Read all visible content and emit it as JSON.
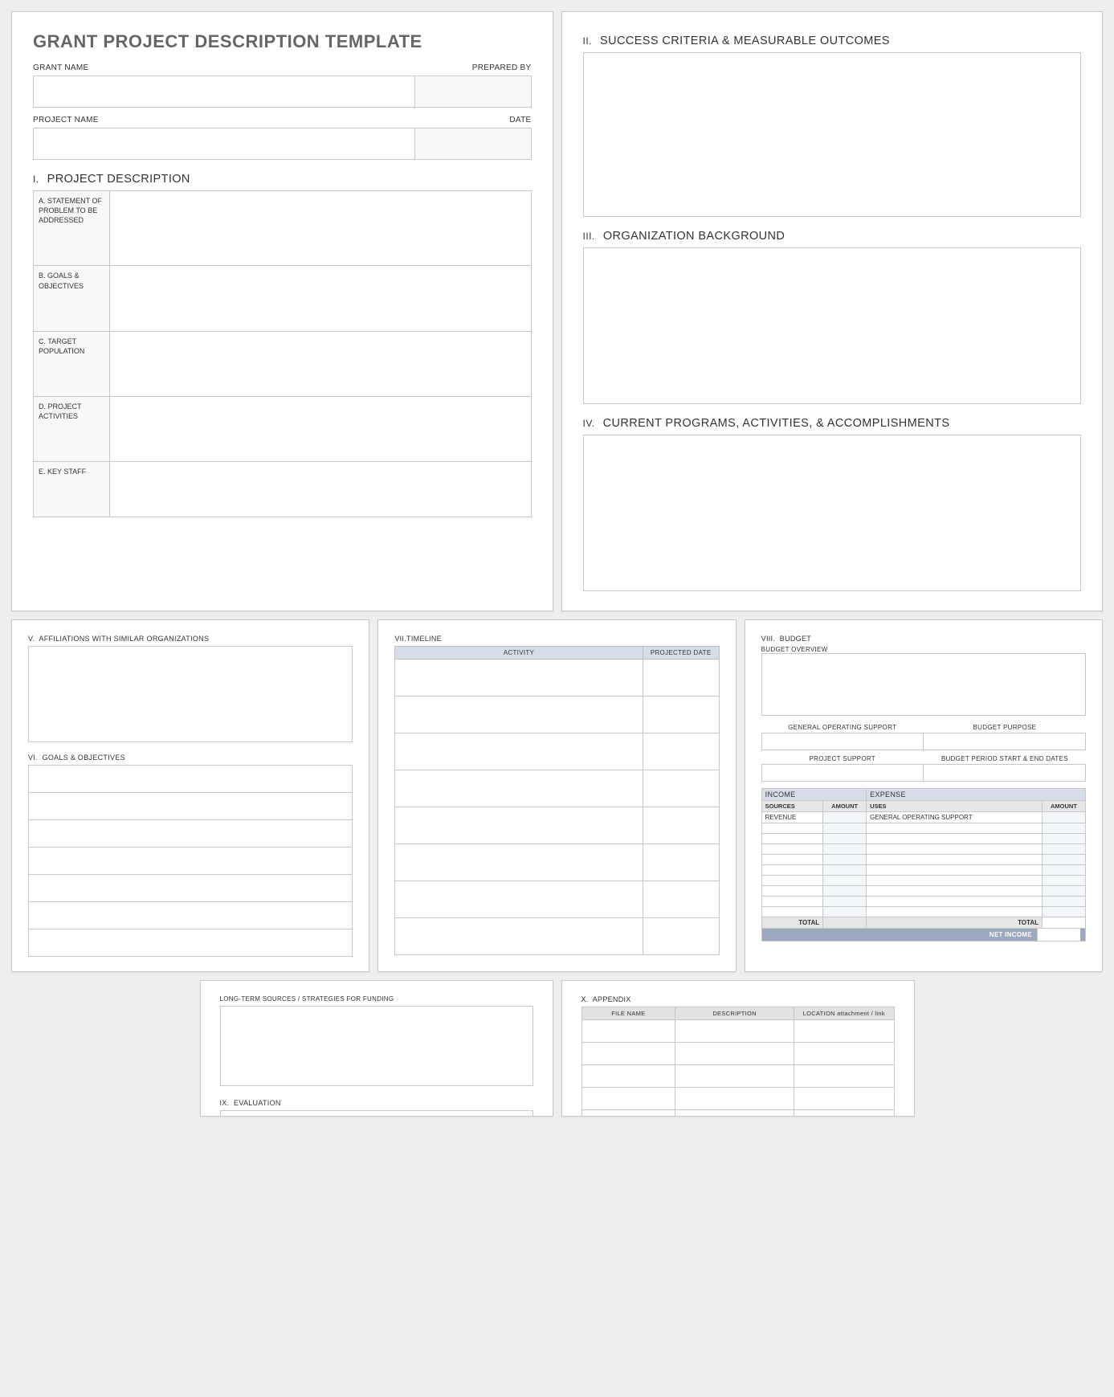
{
  "title": "GRANT PROJECT DESCRIPTION TEMPLATE",
  "header": {
    "grant_name": "GRANT NAME",
    "prepared_by": "PREPARED BY",
    "project_name": "PROJECT NAME",
    "date": "DATE"
  },
  "sections": {
    "s1": {
      "num": "I.",
      "title": "PROJECT DESCRIPTION"
    },
    "s2": {
      "num": "II.",
      "title": "SUCCESS CRITERIA & MEASURABLE OUTCOMES"
    },
    "s3": {
      "num": "III.",
      "title": "ORGANIZATION BACKGROUND"
    },
    "s4": {
      "num": "IV.",
      "title": "CURRENT PROGRAMS, ACTIVITIES, & ACCOMPLISHMENTS"
    },
    "s5": {
      "num": "V.",
      "title": "AFFILIATIONS WITH SIMILAR ORGANIZATIONS"
    },
    "s6": {
      "num": "VI.",
      "title": "GOALS & OBJECTIVES"
    },
    "s7": {
      "num": "VII.",
      "title": "TIMELINE"
    },
    "s8": {
      "num": "VIII.",
      "title": "BUDGET"
    },
    "s9": {
      "num": "IX.",
      "title": "EVALUATION"
    },
    "s10": {
      "num": "X.",
      "title": "APPENDIX"
    }
  },
  "desc_rows": {
    "a": "A.  STATEMENT OF PROBLEM TO BE ADDRESSED",
    "b": "B.  GOALS & OBJECTIVES",
    "c": "C.  TARGET POPULATION",
    "d": "D.  PROJECT ACTIVITIES",
    "e": "E.  KEY STAFF"
  },
  "timeline": {
    "col_activity": "ACTIVITY",
    "col_date": "PROJECTED DATE"
  },
  "budget": {
    "overview": "BUDGET OVERVIEW",
    "gos": "GENERAL OPERATING SUPPORT",
    "purpose": "BUDGET PURPOSE",
    "proj_support": "PROJECT SUPPORT",
    "dates": "BUDGET PERIOD START & END DATES",
    "income": "INCOME",
    "expense": "EXPENSE",
    "sources": "SOURCES",
    "amount": "AMOUNT",
    "uses": "USES",
    "revenue": "REVENUE",
    "gos2": "GENERAL OPERATING SUPPORT",
    "total": "TOTAL",
    "net": "NET INCOME"
  },
  "funding": "LONG-TERM SOURCES / STRATEGIES FOR FUNDING",
  "appendix": {
    "file": "FILE NAME",
    "desc": "DESCRIPTION",
    "loc": "LOCATION attachment / link"
  }
}
